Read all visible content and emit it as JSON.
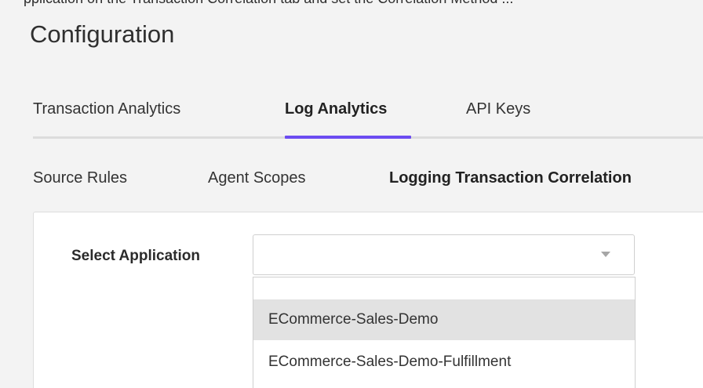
{
  "top_partial_text": "pplication  on  the  Transaction  Correlation  tab  and  set  the  Correlation  Method  ...",
  "page_title": "Configuration",
  "tabs": [
    {
      "label": "Transaction Analytics",
      "active": false
    },
    {
      "label": "Log Analytics",
      "active": true
    },
    {
      "label": "API Keys",
      "active": false
    }
  ],
  "subtabs": [
    {
      "label": "Source Rules",
      "active": false
    },
    {
      "label": "Agent Scopes",
      "active": false
    },
    {
      "label": "Logging Transaction Correlation",
      "active": true
    }
  ],
  "form": {
    "select_application_label": "Select Application",
    "selected_value": "",
    "options": [
      {
        "label": "ECommerce-Sales-Demo",
        "highlighted": true
      },
      {
        "label": "ECommerce-Sales-Demo-Fulfillment",
        "highlighted": false
      }
    ]
  },
  "colors": {
    "accent": "#6c4cf1",
    "background": "#f3f3f3",
    "panel": "#ffffff",
    "highlight": "#e2e2e2"
  }
}
